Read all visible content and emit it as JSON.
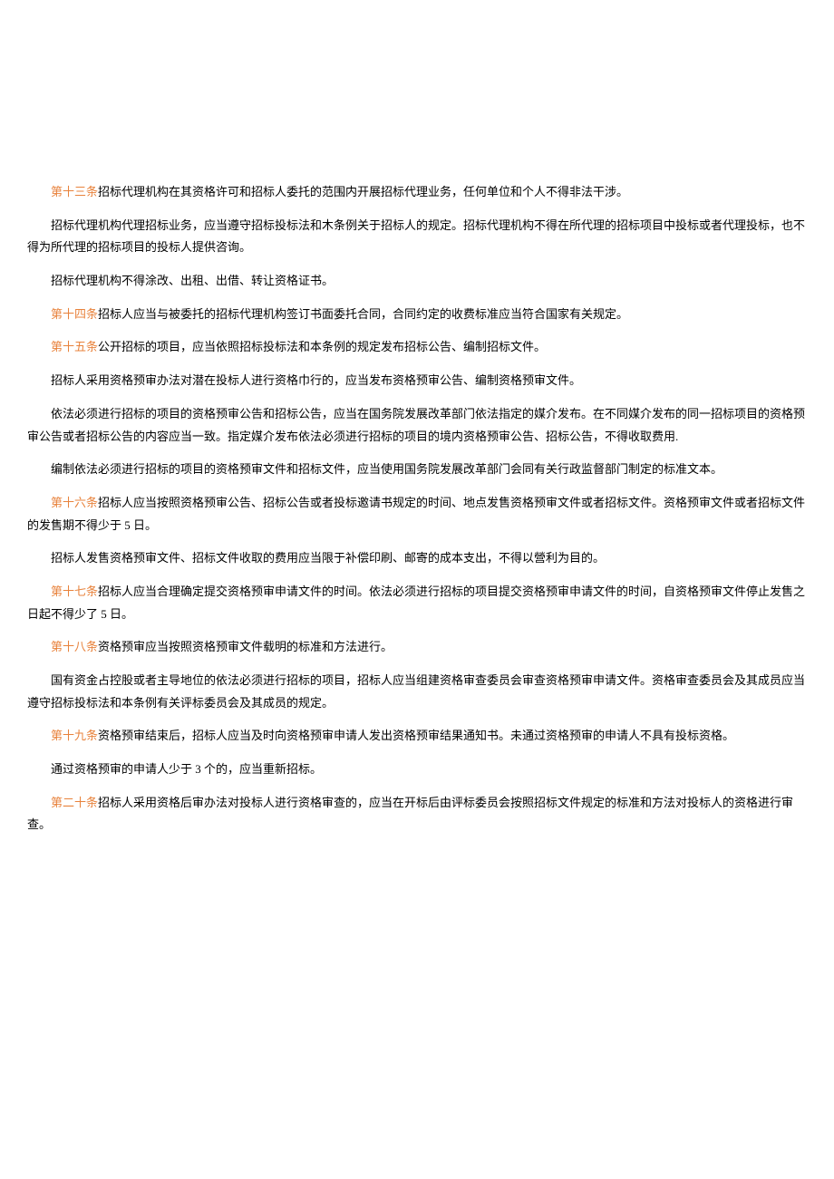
{
  "articles": [
    {
      "label": "第十三条",
      "paragraphs": [
        "招标代理机构在其资格许可和招标人委托的范围内开展招标代理业务，任何单位和个人不得非法干涉。",
        "招标代理机构代理招标业务，应当遵守招标投标法和木条例关于招标人的规定。招标代理机构不得在所代理的招标项目中投标或者代理投标，也不得为所代理的招标项目的投标人提供咨询。",
        "招标代理机构不得涂改、出租、出借、转让资格证书。"
      ]
    },
    {
      "label": "第十四条",
      "paragraphs": [
        "招标人应当与被委托的招标代理机构签订书面委托合同，合同约定的收费标准应当符合国家有关规定。"
      ]
    },
    {
      "label": "第十五条",
      "paragraphs": [
        "公开招标的项目，应当依照招标投标法和本条例的规定发布招标公告、编制招标文件。",
        "招标人采用资格预审办法对潜在投标人进行资格巾行的，应当发布资格预审公告、编制资格预审文件。",
        "依法必须进行招标的项目的资格预审公告和招标公告，应当在国务院发展改革部门依法指定的媒介发布。在不同媒介发布的同一招标项目的资格预审公告或者招标公告的内容应当一致。指定媒介发布依法必须进行招标的项目的境内资格预审公告、招标公告，不得收取费用.",
        "编制依法必须进行招标的项目的资格预审文件和招标文件，应当使用国务院发展改革部门会同有关行政监督部门制定的标准文本。"
      ]
    },
    {
      "label": "第十六条",
      "paragraphs": [
        "招标人应当按照资格预审公告、招标公告或者投标邀请书规定的时间、地点发售资格预审文件或者招标文件。资格预审文件或者招标文件的发售期不得少于 5 日。",
        "招标人发售资格预审文件、招标文件收取的费用应当限于补偿印刷、邮寄的成本支出，不得以營利为目的。"
      ]
    },
    {
      "label": "第十七条",
      "paragraphs": [
        "招标人应当合理确定提交资格预审申请文件的时间。依法必须进行招标的项目提交资格预审申请文件的时间，自资格预审文件停止发售之日起不得少了 5 日。"
      ]
    },
    {
      "label": "第十八条",
      "paragraphs": [
        "资格预审应当按照资格预审文件载明的标准和方法进行。",
        "国有资金占控股或者主导地位的依法必须进行招标的项目，招标人应当组建资格审查委员会审查资格预审申请文件。资格审查委员会及其成员应当遵守招标投标法和本条例有关评标委员会及其成员的规定。"
      ]
    },
    {
      "label": "第十九条",
      "paragraphs": [
        "资格预审结束后，招标人应当及时向资格预审申请人发出资格预审结果通知书。未通过资格预审的申请人不具有投标资格。",
        "通过资格预审的申请人少于 3 个的，应当重新招标。"
      ]
    },
    {
      "label": "第二十条",
      "paragraphs": [
        "招标人采用资格后审办法对投标人进行资格审查的，应当在开标后由评标委员会按照招标文件规定的标准和方法对投标人的资格进行审查。"
      ]
    }
  ]
}
